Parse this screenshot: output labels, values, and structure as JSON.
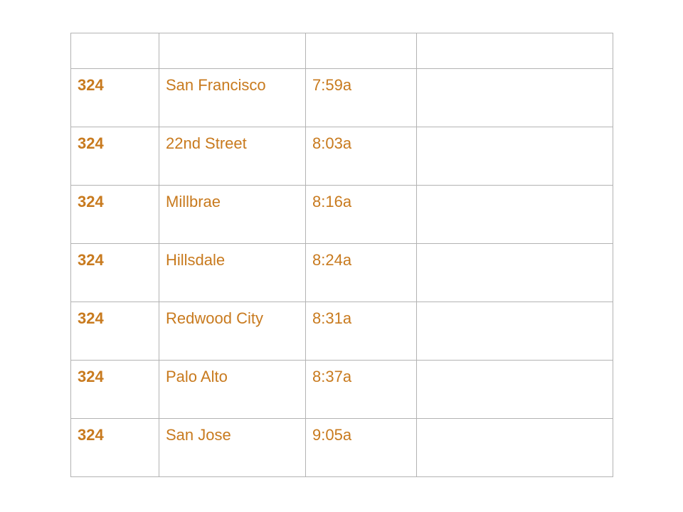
{
  "header": [
    "",
    "",
    "",
    ""
  ],
  "rows": [
    {
      "train": "324",
      "station": "San Francisco",
      "time": "7:59a",
      "note": ""
    },
    {
      "train": "324",
      "station": "22nd Street",
      "time": "8:03a",
      "note": ""
    },
    {
      "train": "324",
      "station": "Millbrae",
      "time": "8:16a",
      "note": ""
    },
    {
      "train": "324",
      "station": "Hillsdale",
      "time": "8:24a",
      "note": ""
    },
    {
      "train": "324",
      "station": "Redwood City",
      "time": "8:31a",
      "note": ""
    },
    {
      "train": "324",
      "station": "Palo Alto",
      "time": "8:37a",
      "note": ""
    },
    {
      "train": "324",
      "station": "San Jose",
      "time": "9:05a",
      "note": ""
    }
  ],
  "colors": {
    "text": "#c87a1e",
    "border": "#b3b3b3"
  }
}
